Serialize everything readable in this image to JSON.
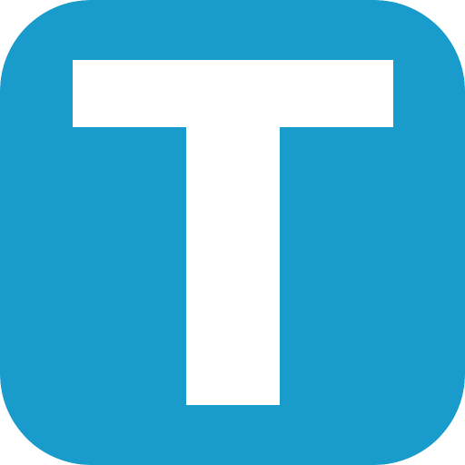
{
  "app_icon": {
    "letter": "T",
    "icon_name": "t-letter-icon",
    "background_color": "#199bcc",
    "letter_color": "#ffffff"
  }
}
